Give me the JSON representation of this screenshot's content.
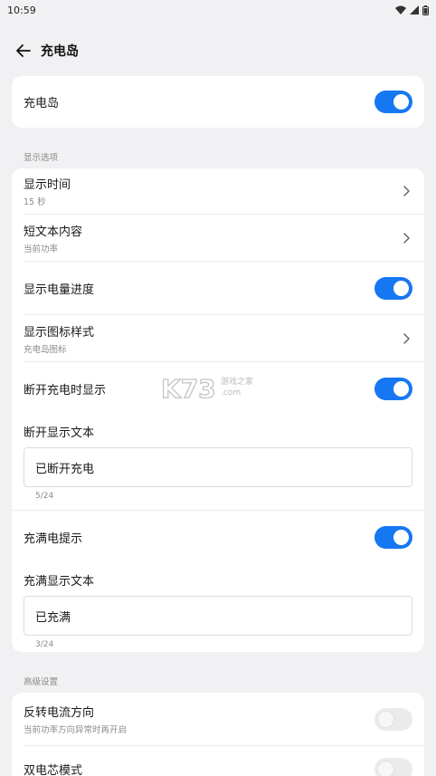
{
  "status_bar": {
    "time": "10:59"
  },
  "header": {
    "title": "充电岛"
  },
  "main_toggle": {
    "label": "充电岛",
    "on": true
  },
  "display_section": {
    "label": "显示选项",
    "show_time": {
      "title": "显示时间",
      "value": "15 秒"
    },
    "short_text": {
      "title": "短文本内容",
      "value": "当前功率"
    },
    "show_battery_progress": {
      "title": "显示电量进度",
      "on": true
    },
    "icon_style": {
      "title": "显示图标样式",
      "value": "充电岛图标"
    },
    "show_on_disconnect": {
      "title": "断开充电时显示",
      "on": true
    },
    "disconnect_text": {
      "label": "断开显示文本",
      "value": "已断开充电",
      "counter": "5/24"
    },
    "full_charge_hint": {
      "title": "充满电提示",
      "on": true
    },
    "full_text": {
      "label": "充满显示文本",
      "value": "已充满",
      "counter": "3/24"
    }
  },
  "advanced_section": {
    "label": "高级设置",
    "reverse_current": {
      "title": "反转电流方向",
      "subtitle": "当前功率方向异常时再开启",
      "on": false
    },
    "dual_cell": {
      "title": "双电芯模式",
      "on": false
    }
  },
  "watermark": {
    "logo": "K73",
    "line1": "游戏之家",
    "line2": ".com"
  },
  "colors": {
    "accent": "#1677f2",
    "background": "#f1f1f3",
    "card": "#ffffff"
  }
}
